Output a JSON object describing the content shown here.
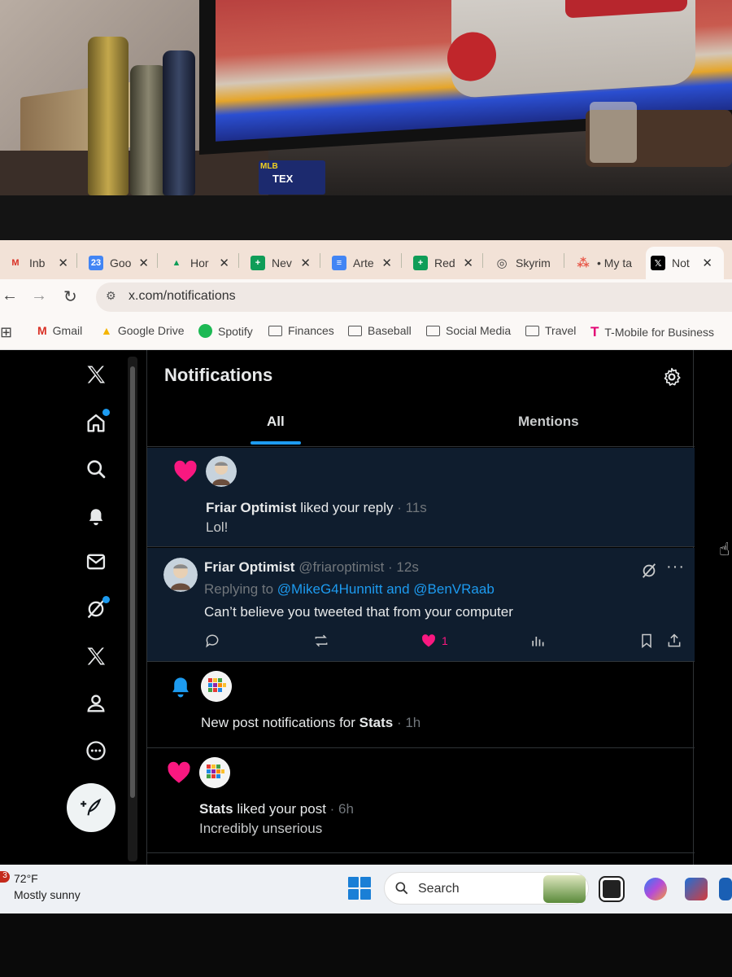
{
  "room": {
    "scoreboard": {
      "league": "MLB",
      "team": "TEX"
    }
  },
  "browser": {
    "tabs": [
      {
        "label": "Inb",
        "icon_text": "M",
        "color": "#d93025"
      },
      {
        "label": "Goo",
        "icon_text": "23",
        "color": "#4285f4"
      },
      {
        "label": "Hor",
        "icon_text": "▲",
        "color": "#0f9d58"
      },
      {
        "label": "Nev",
        "icon_text": "+",
        "color": "#0f9d58"
      },
      {
        "label": "Arte",
        "icon_text": "≡",
        "color": "#4285f4"
      },
      {
        "label": "Red",
        "icon_text": "+",
        "color": "#0f9d58"
      },
      {
        "label": "Skyrim",
        "icon_text": "◎",
        "color": "#444444"
      },
      {
        "label": "• My ta",
        "icon_text": "⁂",
        "color": "#e8594a"
      },
      {
        "label": "Not",
        "icon_text": "𝕏",
        "color": "#000000"
      }
    ],
    "url": "x.com/notifications",
    "bookmarks": [
      "Gmail",
      "Google Drive",
      "Spotify",
      "Finances",
      "Baseball",
      "Social Media",
      "Travel",
      "T-Mobile for Business"
    ]
  },
  "x": {
    "header_title": "Notifications",
    "tabs": {
      "all": "All",
      "mentions": "Mentions"
    },
    "notifications": [
      {
        "type": "like",
        "user": "Friar Optimist",
        "action": "liked your reply",
        "time": "· 11s",
        "snippet": "Lol!"
      },
      {
        "type": "reply",
        "user": "Friar Optimist",
        "handle": "@friaroptimist",
        "time": "· 12s",
        "replying_prefix": "Replying to",
        "replying_to": "@MikeG4Hunnitt and @BenVRaab",
        "text": "Can’t believe you tweeted that from your computer",
        "likes": "1"
      },
      {
        "type": "new_post",
        "prefix": "New post notifications for",
        "user": "Stats",
        "time": "· 1h"
      },
      {
        "type": "like",
        "user": "Stats",
        "action": "liked your post",
        "time": "· 6h",
        "snippet": "Incredibly unserious"
      }
    ]
  },
  "taskbar": {
    "badge": "3",
    "temp": "72°F",
    "condition": "Mostly sunny",
    "search_label": "Search"
  },
  "colors": {
    "x_blue": "#1d9bf0",
    "like_pink": "#f91880",
    "unread_bg": "#0f1d2e"
  }
}
